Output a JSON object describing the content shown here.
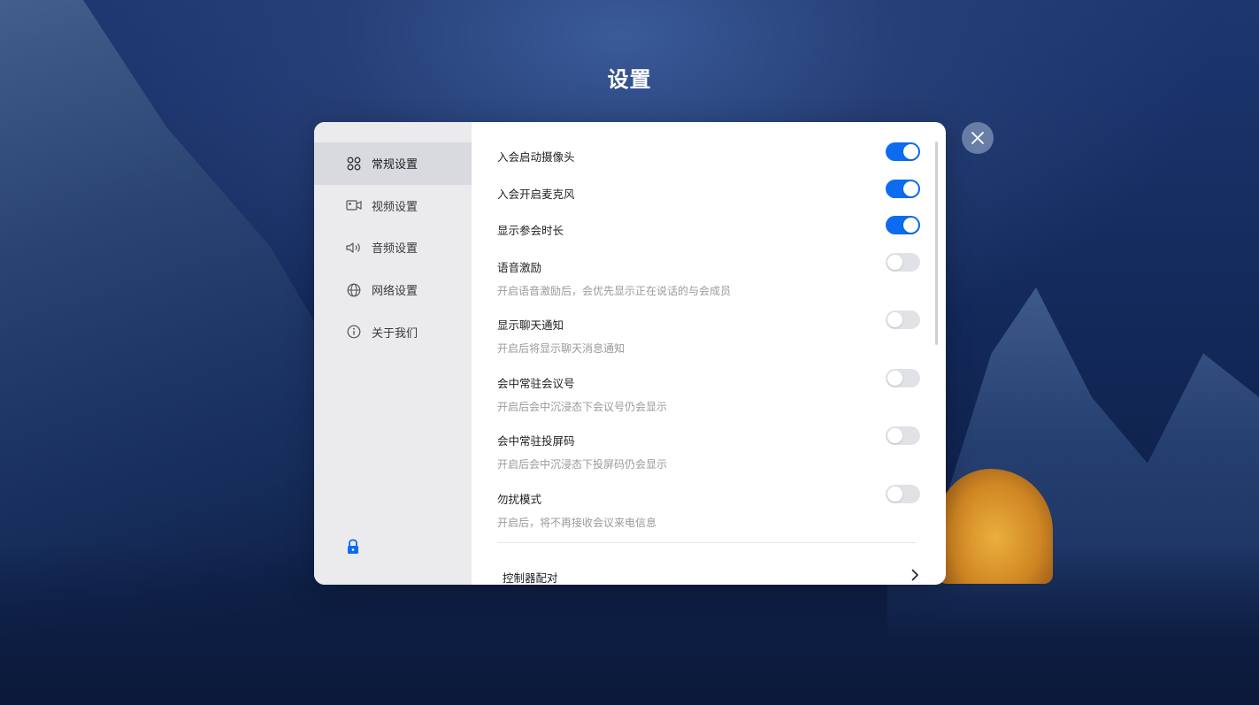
{
  "page_title": "设置",
  "sidebar": {
    "items": [
      {
        "label": "常规设置",
        "icon": "grid-icon",
        "active": true
      },
      {
        "label": "视频设置",
        "icon": "video-camera-icon",
        "active": false
      },
      {
        "label": "音频设置",
        "icon": "speaker-icon",
        "active": false
      },
      {
        "label": "网络设置",
        "icon": "globe-icon",
        "active": false
      },
      {
        "label": "关于我们",
        "icon": "info-icon",
        "active": false
      }
    ],
    "lock_icon": "lock-icon"
  },
  "settings": [
    {
      "title": "入会启动摄像头",
      "desc": "",
      "on": true
    },
    {
      "title": "入会开启麦克风",
      "desc": "",
      "on": true
    },
    {
      "title": "显示参会时长",
      "desc": "",
      "on": true
    },
    {
      "title": "语音激励",
      "desc": "开启语音激励后，会优先显示正在说话的与会成员",
      "on": false
    },
    {
      "title": "显示聊天通知",
      "desc": "开启后将显示聊天消息通知",
      "on": false
    },
    {
      "title": "会中常驻会议号",
      "desc": "开启后会中沉浸态下会议号仍会显示",
      "on": false
    },
    {
      "title": "会中常驻投屏码",
      "desc": "开启后会中沉浸态下投屏码仍会显示",
      "on": false
    },
    {
      "title": "勿扰模式",
      "desc": "开启后，将不再接收会议来电信息",
      "on": false
    }
  ],
  "link_row": {
    "label": "控制器配对"
  },
  "colors": {
    "accent": "#0c6bf0",
    "toggle_off": "#e1e2e6",
    "sidebar_bg": "#ebebee",
    "sidebar_active": "#d9dadf"
  }
}
